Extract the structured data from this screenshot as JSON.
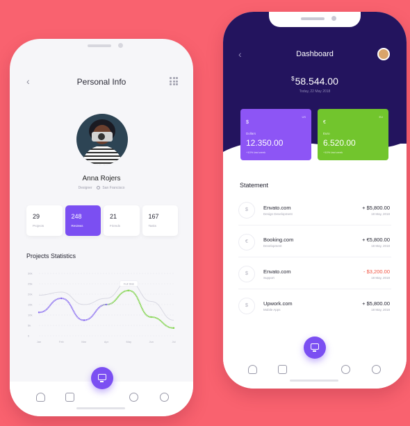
{
  "personal": {
    "title": "Personal Info",
    "name": "Anna Rojers",
    "role": "Designer",
    "location": "San Francisco",
    "stats": [
      {
        "value": "29",
        "label": "Projects"
      },
      {
        "value": "248",
        "label": "Reviews"
      },
      {
        "value": "21",
        "label": "Friends"
      },
      {
        "value": "167",
        "label": "Tasks"
      }
    ],
    "section_title": "Projects Statistics"
  },
  "chart_data": {
    "type": "line",
    "title": "Projects Statistics",
    "x": [
      "Jan",
      "Feb",
      "Mar",
      "Apr",
      "May",
      "Jun",
      "Jul"
    ],
    "series": [
      {
        "values": [
          30,
          48,
          20,
          40,
          58,
          24,
          10
        ]
      },
      {
        "values": [
          52,
          56,
          40,
          48,
          70,
          44,
          20
        ]
      }
    ],
    "y_ticks": [
      "0",
      "5k",
      "10k",
      "15k",
      "20k",
      "25k",
      "30k"
    ],
    "tooltip": "Full Stat",
    "ylim": [
      0,
      80
    ],
    "colors": [
      "#8b6ff0",
      "#7ed348",
      "#d8d8e2"
    ]
  },
  "dashboard": {
    "title": "Dashboard",
    "currency": "$",
    "balance": "58.544.00",
    "date": "Today, 22 May 2018",
    "cards": [
      {
        "symbol": "$",
        "corner": "US",
        "label": "Dollars",
        "amount": "12.350.00",
        "sub": "+10% last week"
      },
      {
        "symbol": "€",
        "corner": "EU",
        "label": "Euro",
        "amount": "6.520.00",
        "sub": "+10% last week"
      }
    ],
    "statement_title": "Statement",
    "transactions": [
      {
        "icon": "$",
        "name": "Envato.com",
        "sub": "Design Development",
        "amount": "+ $5,800.00",
        "date": "18 May, 2018",
        "negative": false
      },
      {
        "icon": "€",
        "name": "Booking.com",
        "sub": "Development",
        "amount": "+ €5,800.00",
        "date": "18 May, 2018",
        "negative": false
      },
      {
        "icon": "$",
        "name": "Envato.com",
        "sub": "Support",
        "amount": "- $3,200.00",
        "date": "18 May, 2018",
        "negative": true
      },
      {
        "icon": "$",
        "name": "Upwork.com",
        "sub": "Mobile Apps",
        "amount": "+ $5,800.00",
        "date": "18 May, 2018",
        "negative": false
      }
    ]
  },
  "colors": {
    "background": "#f9626f",
    "purple": "#7b4ff2",
    "navy": "#23145e",
    "green": "#72c52d",
    "negative": "#f0503e"
  },
  "icons": {
    "back": "‹",
    "nav": [
      "user-icon",
      "mail-icon",
      "monitor-icon",
      "settings-icon",
      "pie-chart-icon"
    ]
  }
}
